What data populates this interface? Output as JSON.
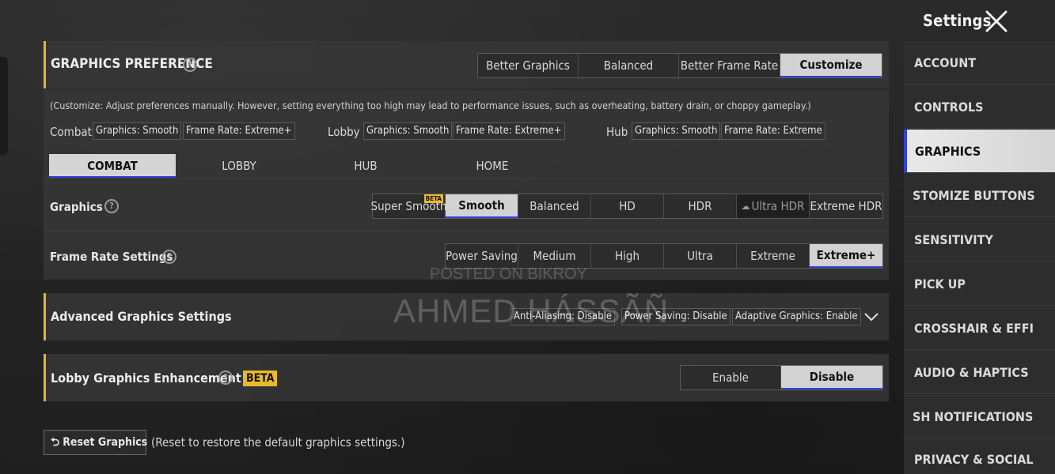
{
  "header": {
    "title": "Settings"
  },
  "preference": {
    "title": "GRAPHICS PREFERENCE",
    "options": [
      "Better Graphics",
      "Balanced",
      "Better Frame Rate",
      "Customize"
    ],
    "selected": "Customize",
    "note": "(Customize: Adjust preferences manually. However, setting everything too high may lead to performance issues, such as overheating, battery drain, or choppy gameplay.)"
  },
  "summary": [
    {
      "label": "Combat",
      "graphics": "Graphics: Smooth",
      "frame_rate": "Frame Rate: Extreme+"
    },
    {
      "label": "Lobby",
      "graphics": "Graphics: Smooth",
      "frame_rate": "Frame Rate: Extreme+"
    },
    {
      "label": "Hub",
      "graphics": "Graphics: Smooth",
      "frame_rate": "Frame Rate: Extreme"
    }
  ],
  "tabs": [
    "COMBAT",
    "LOBBY",
    "HUB",
    "HOME"
  ],
  "graphics": {
    "label": "Graphics",
    "options": [
      "Super Smooth",
      "Smooth",
      "Balanced",
      "HD",
      "HDR",
      "Ultra HDR",
      "Extreme HDR"
    ],
    "beta_tag": "BETA",
    "selected": "Smooth"
  },
  "frame_rate": {
    "label": "Frame Rate Settings",
    "options": [
      "Power Saving",
      "Medium",
      "High",
      "Ultra",
      "Extreme",
      "Extreme+"
    ],
    "selected": "Extreme+"
  },
  "advanced": {
    "label": "Advanced Graphics Settings",
    "chips": [
      "Anti-Aliasing: Disable",
      "Power Saving: Disable",
      "Adaptive Graphics: Enable"
    ]
  },
  "lobby_enhancement": {
    "label": "Lobby Graphics Enhancement",
    "beta": "BETA",
    "options": [
      "Enable",
      "Disable"
    ],
    "selected": "Disable"
  },
  "reset": {
    "button": "Reset Graphics",
    "note": "(Reset to restore the default graphics settings.)"
  },
  "sidebar": {
    "items": [
      "ACCOUNT",
      "CONTROLS",
      "GRAPHICS",
      "STOMIZE BUTTONS",
      "SENSITIVITY",
      "PICK UP",
      "CROSSHAIR & EFFI",
      "AUDIO & HAPTICS",
      "SH NOTIFICATIONS",
      "PRIVACY & SOCIAL"
    ],
    "selected": "GRAPHICS"
  },
  "watermarks": [
    "POSTED ON BIKROY",
    "AHMED HÁSSÃÑ"
  ],
  "colors": {
    "accent": "#e0b43a",
    "selected_bg": "#d2d2d2",
    "selected_underline": "#2f3fd8",
    "beta": "#e8b82f"
  }
}
